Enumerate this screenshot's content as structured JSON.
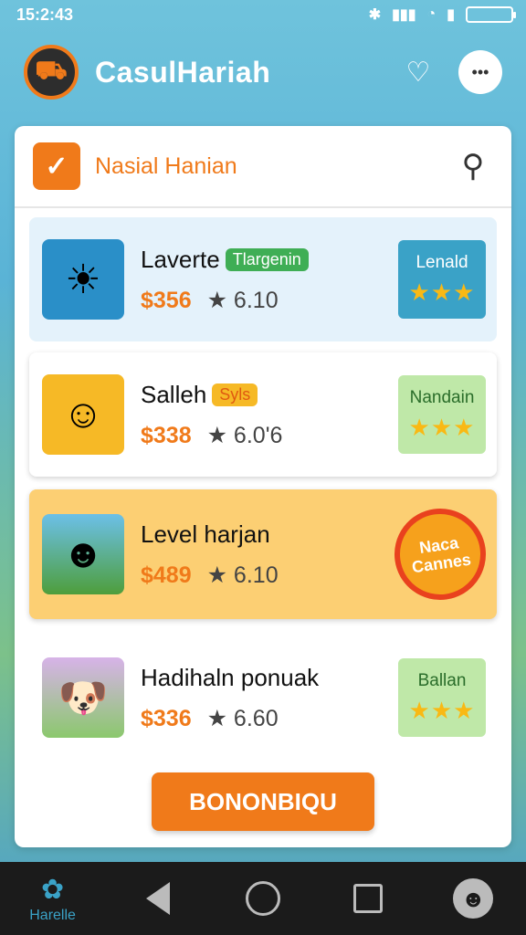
{
  "status_bar": {
    "time": "15:2:43"
  },
  "app_bar": {
    "title": "CasulHariah"
  },
  "card": {
    "header_title": "Nasial Hanian",
    "items": [
      {
        "title": "Laverte",
        "tag": "Tlargenin",
        "price": "$356",
        "rating": "★ 6.10",
        "badge": "Lenald",
        "stars": "★★★"
      },
      {
        "title": "Salleh",
        "tag": "Syls",
        "price": "$338",
        "rating": "★ 6.0'6",
        "badge": "Nandain",
        "stars": "★★★"
      },
      {
        "title": "Level harjan",
        "tag": "",
        "price": "$489",
        "rating": "★ 6.10",
        "badge": "Naca Cannes",
        "stars": ""
      },
      {
        "title": "Hadihaln ponuak",
        "tag": "",
        "price": "$336",
        "rating": "★ 6.60",
        "badge": "Ballan",
        "stars": "★★★"
      }
    ],
    "cta_label": "BONONBIQU"
  },
  "nav_bar": {
    "home_label": "Harelle"
  },
  "colors": {
    "accent": "#f07a1a",
    "appbar": "#6fc3dc",
    "star": "#f9b914",
    "tag_green": "#3fae55"
  }
}
